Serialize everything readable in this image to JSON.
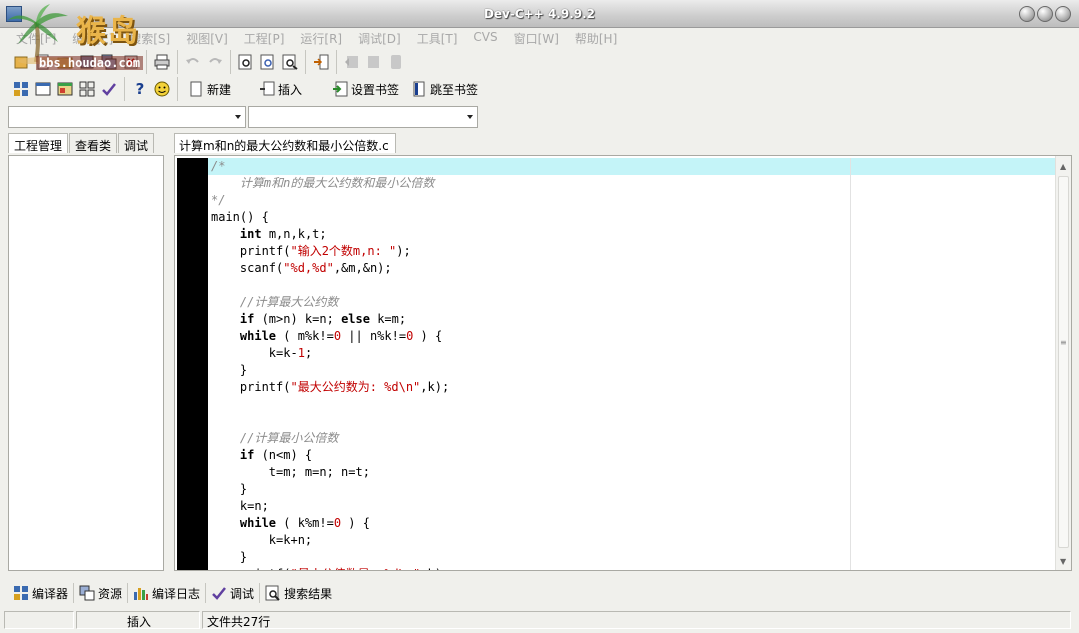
{
  "window": {
    "title": "Dev-C++ 4.9.9.2"
  },
  "watermark": {
    "text_cn": "猴岛",
    "url": "bbs.houdao.com"
  },
  "menu": [
    "文件[F]",
    "编辑[E]",
    "搜索[S]",
    "视图[V]",
    "工程[P]",
    "运行[R]",
    "调试[D]",
    "工具[T]",
    "CVS",
    "窗口[W]",
    "帮助[H]"
  ],
  "toolbar2": {
    "new_label": "新建",
    "insert_label": "插入",
    "set_bookmark_label": "设置书签",
    "goto_bookmark_label": "跳至书签"
  },
  "left_tabs": [
    "工程管理",
    "查看类",
    "调试"
  ],
  "editor": {
    "file_tab": "计算m和n的最大公约数和最小公倍数.c",
    "highlighted_line": 0,
    "lines": [
      "/*",
      "    计算m和n的最大公约数和最小公倍数",
      "*/",
      "main() {",
      "    int m,n,k,t;",
      "    printf(\"输入2个数m,n: \");",
      "    scanf(\"%d,%d\",&m,&n);",
      "",
      "    //计算最大公约数",
      "    if (m>n) k=n; else k=m;",
      "    while ( m%k!=0 || n%k!=0 ) {",
      "        k=k-1;",
      "    }",
      "    printf(\"最大公约数为: %d\\n\",k);",
      "",
      "",
      "    //计算最小公倍数",
      "    if (n<m) {",
      "        t=m; m=n; n=t;",
      "    }",
      "    k=n;",
      "    while ( k%m!=0 ) {",
      "        k=k+n;",
      "    }",
      "    printf(\"最小公倍数是: %d\\n\",k);"
    ]
  },
  "bottom_tabs": [
    {
      "label": "编译器",
      "icon": "grid-icon"
    },
    {
      "label": "资源",
      "icon": "resource-icon"
    },
    {
      "label": "编译日志",
      "icon": "chart-icon"
    },
    {
      "label": "调试",
      "icon": "check-icon"
    },
    {
      "label": "搜索结果",
      "icon": "search-icon"
    }
  ],
  "status": {
    "position": "",
    "mode": "插入",
    "info": "文件共27行"
  },
  "colors": {
    "highlight": "#c4f4f8",
    "string": "#c10000",
    "comment": "#8c8c8c",
    "gutter": "#000000"
  }
}
